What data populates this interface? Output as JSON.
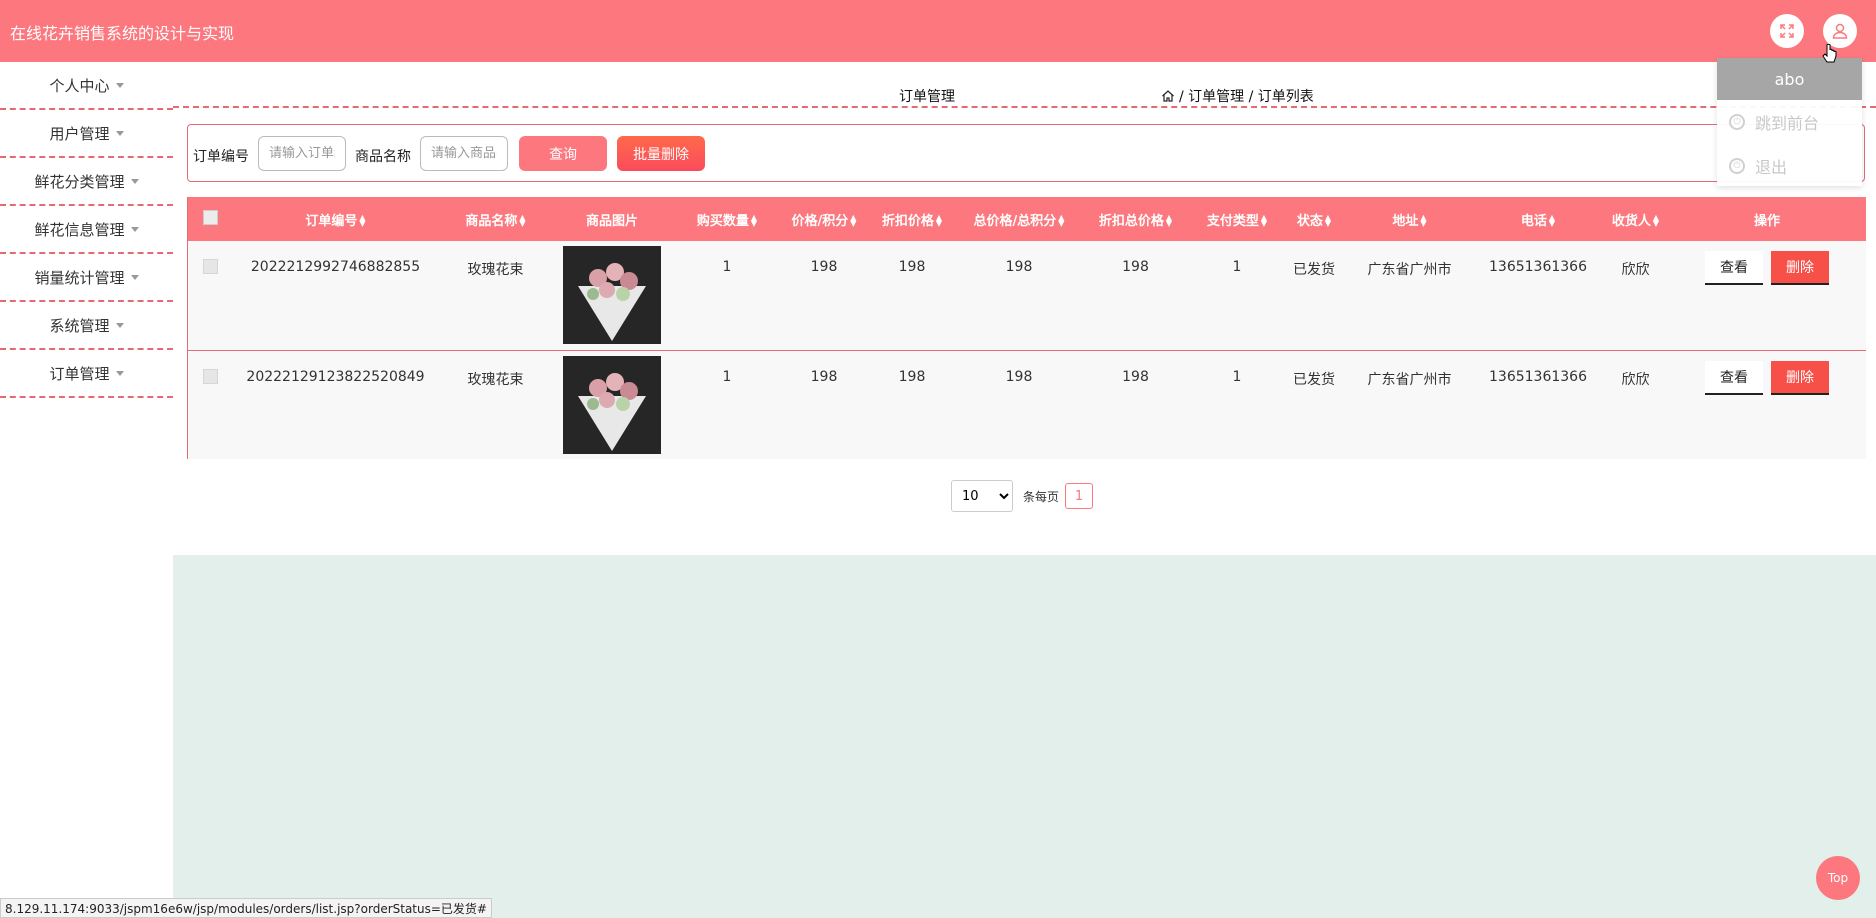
{
  "header": {
    "app_title": "在线花卉销售系统的设计与实现",
    "fullscreen_icon": "fullscreen-icon",
    "user_icon": "user-icon"
  },
  "user_menu": {
    "username": "abo",
    "items": [
      {
        "label": "跳到前台",
        "icon": "power-icon"
      },
      {
        "label": "退出",
        "icon": "power-icon"
      }
    ]
  },
  "sidebar": {
    "items": [
      {
        "label": "个人中心"
      },
      {
        "label": "用户管理"
      },
      {
        "label": "鲜花分类管理"
      },
      {
        "label": "鲜花信息管理"
      },
      {
        "label": "销量统计管理"
      },
      {
        "label": "系统管理"
      },
      {
        "label": "订单管理"
      }
    ]
  },
  "breadcrumb": {
    "title": "订单管理",
    "path": "/ 订单管理 / 订单列表"
  },
  "search": {
    "order_no_label": "订单编号",
    "order_no_placeholder": "请输入订单编号",
    "product_label": "商品名称",
    "product_placeholder": "请输入商品名称",
    "query_button": "查询",
    "batch_delete_button": "批量删除"
  },
  "table": {
    "columns": [
      "订单编号",
      "商品名称",
      "商品图片",
      "购买数量",
      "价格/积分",
      "折扣价格",
      "总价格/总积分",
      "折扣总价格",
      "支付类型",
      "状态",
      "地址",
      "电话",
      "收货人",
      "操作"
    ],
    "rows": [
      {
        "order_no": "2022212992746882855",
        "product": "玫瑰花束",
        "quantity": "1",
        "price": "198",
        "discount_price": "198",
        "total": "198",
        "discount_total": "198",
        "pay_type": "1",
        "status": "已发货",
        "address": "广东省广州市",
        "phone": "13651361366",
        "receiver": "欣欣",
        "view": "查看",
        "delete": "删除"
      },
      {
        "order_no": "20222129123822520849",
        "product": "玫瑰花束",
        "quantity": "1",
        "price": "198",
        "discount_price": "198",
        "total": "198",
        "discount_total": "198",
        "pay_type": "1",
        "status": "已发货",
        "address": "广东省广州市",
        "phone": "13651361366",
        "receiver": "欣欣",
        "view": "查看",
        "delete": "删除"
      }
    ]
  },
  "pagination": {
    "page_size": "10",
    "per_page_label": "条每页",
    "current_page": "1"
  },
  "status_bar_url": "8.129.11.174:9033/jspm16e6w/jsp/modules/orders/list.jsp?orderStatus=已发货#",
  "top_button": "Top",
  "colors": {
    "accent": "#fc787e",
    "danger": "#f75049",
    "bottom_bg": "#e2efeb"
  }
}
